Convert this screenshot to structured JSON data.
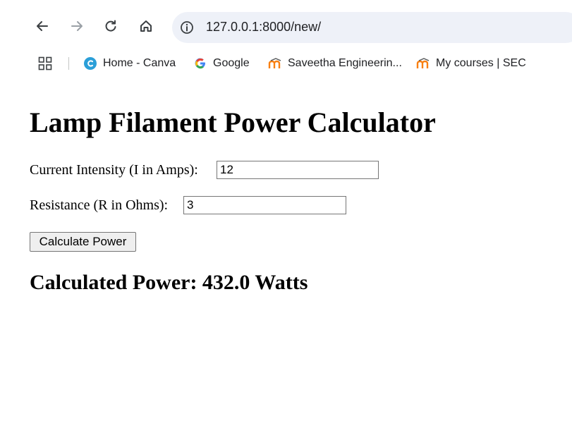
{
  "browser": {
    "url": "127.0.0.1:8000/new/",
    "icons": {
      "back": "arrow-left-icon",
      "forward": "arrow-right-icon",
      "reload": "reload-icon",
      "home": "home-icon",
      "site_info": "info-icon",
      "apps": "apps-grid-icon"
    },
    "bookmarks": [
      {
        "label": "Home - Canva",
        "icon": "canva-icon",
        "color": "#2b9fd8"
      },
      {
        "label": "Google",
        "icon": "google-icon",
        "color": "#4285f4"
      },
      {
        "label": "Saveetha Engineerin...",
        "icon": "moodle-icon",
        "color": "#f98012"
      },
      {
        "label": "My courses | SEC",
        "icon": "moodle-icon",
        "color": "#f98012"
      }
    ]
  },
  "page": {
    "title": "Lamp Filament Power Calculator",
    "current": {
      "label": "Current Intensity (I in Amps):",
      "value": "12"
    },
    "resistance": {
      "label": "Resistance (R in Ohms):",
      "value": "3"
    },
    "button_label": "Calculate Power",
    "result": "Calculated Power: 432.0 Watts"
  }
}
